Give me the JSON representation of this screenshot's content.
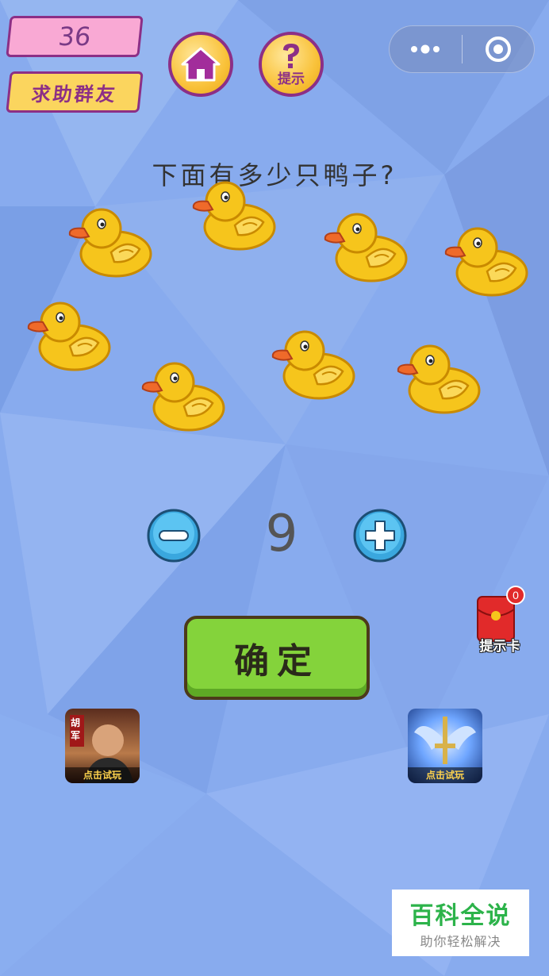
{
  "header": {
    "level": "36",
    "help_label": "求助群友",
    "hint_label": "提示",
    "colors": {
      "accent_purple": "#8c2f86",
      "gold": "#f9c23a",
      "pink": "#f9a9d4"
    }
  },
  "capsule": {
    "more_icon": "more-dots-icon",
    "close_icon": "target-close-icon"
  },
  "question": "下面有多少只鸭子?",
  "ducks": {
    "count": 8,
    "icon": "rubber-duck-icon"
  },
  "answer": {
    "value": "9"
  },
  "confirm_label": "确定",
  "hint_card": {
    "badge": "0",
    "label": "提示卡"
  },
  "ads": {
    "left": {
      "label": "点击试玩",
      "logo_text": "胡军"
    },
    "right": {
      "label": "点击试玩"
    }
  },
  "watermark": {
    "title": "百科全说",
    "subtitle": "助你轻松解决"
  }
}
